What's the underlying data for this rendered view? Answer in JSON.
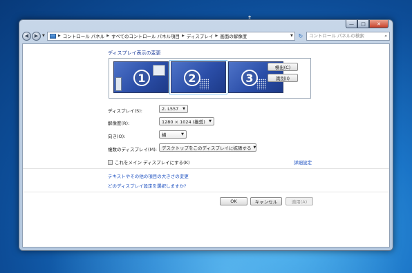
{
  "window": {
    "caption": {
      "minimize": "—",
      "maximize": "□",
      "close": "✕"
    }
  },
  "toolbar": {
    "back_icon": "◀",
    "forward_icon": "▶",
    "breadcrumbs": [
      "コントロール パネル",
      "すべてのコントロール パネル項目",
      "ディスプレイ",
      "画面の解像度"
    ],
    "search_placeholder": "コントロール パネルの検索"
  },
  "main": {
    "title": "ディスプレイ表示の変更",
    "monitors": [
      {
        "number": "1",
        "selected": false
      },
      {
        "number": "2",
        "selected": true
      },
      {
        "number": "3",
        "selected": false
      }
    ],
    "detect_button": "検出(C)",
    "identify_button": "識別(I)",
    "display_label": "ディスプレイ(S):",
    "display_value": "2. L557",
    "resolution_label": "解像度(R):",
    "resolution_value": "1280 × 1024 (推奨)",
    "orientation_label": "向き(O):",
    "orientation_value": "横",
    "multiple_label": "複数のディスプレイ(M):",
    "multiple_value": "デスクトップをこのディスプレイに拡張する",
    "main_display_checkbox": "これをメイン ディスプレイにする(K)",
    "advanced_link": "詳細設定",
    "text_size_link": "テキストやその他の項目の大きさの変更",
    "help_link": "どのディスプレイ設定を選択しますか?"
  },
  "footer": {
    "ok": "OK",
    "cancel": "キャンセル",
    "apply": "適用(A)"
  }
}
